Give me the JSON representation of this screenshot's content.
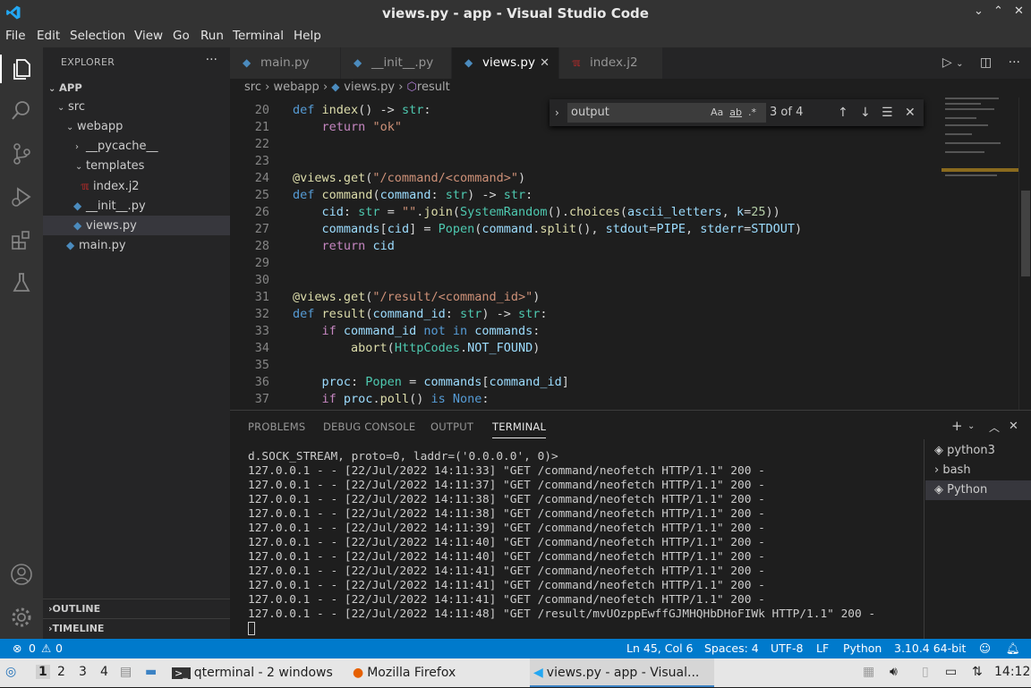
{
  "window": {
    "title": "views.py - app - Visual Studio Code",
    "controls": [
      "⌄",
      "⌃",
      "✕"
    ]
  },
  "menu": [
    "File",
    "Edit",
    "Selection",
    "View",
    "Go",
    "Run",
    "Terminal",
    "Help"
  ],
  "explorer": {
    "header": "EXPLORER",
    "more": "···",
    "root": "APP",
    "items": [
      {
        "label": "src"
      },
      {
        "label": "webapp"
      },
      {
        "label": "__pycache__"
      },
      {
        "label": "templates"
      },
      {
        "label": "index.j2"
      },
      {
        "label": "__init__.py"
      },
      {
        "label": "views.py"
      },
      {
        "label": "main.py"
      }
    ],
    "outline": "OUTLINE",
    "timeline": "TIMELINE"
  },
  "tabs": [
    {
      "label": "main.py"
    },
    {
      "label": "__init__.py"
    },
    {
      "label": "views.py"
    },
    {
      "label": "index.j2"
    }
  ],
  "breadcrumb": [
    "src",
    "webapp",
    "views.py",
    "result"
  ],
  "find": {
    "query": "output",
    "count": "3 of 4",
    "opt_case": "Aa",
    "opt_word": "ab",
    "opt_regex": ".*"
  },
  "code_lines": [
    {
      "n": "20"
    },
    {
      "n": "21"
    },
    {
      "n": "22"
    },
    {
      "n": "23"
    },
    {
      "n": "24"
    },
    {
      "n": "25"
    },
    {
      "n": "26"
    },
    {
      "n": "27"
    },
    {
      "n": "28"
    },
    {
      "n": "29"
    },
    {
      "n": "30"
    },
    {
      "n": "31"
    },
    {
      "n": "32"
    },
    {
      "n": "33"
    },
    {
      "n": "34"
    },
    {
      "n": "35"
    },
    {
      "n": "36"
    },
    {
      "n": "37"
    }
  ],
  "panel": {
    "tabs": [
      "PROBLEMS",
      "DEBUG CONSOLE",
      "OUTPUT",
      "TERMINAL"
    ],
    "active_tab": "TERMINAL",
    "terminal_lines": [
      "d.SOCK_STREAM, proto=0, laddr=('0.0.0.0', 0)>",
      "127.0.0.1 - - [22/Jul/2022 14:11:33] \"GET /command/neofetch HTTP/1.1\" 200 -",
      "127.0.0.1 - - [22/Jul/2022 14:11:37] \"GET /command/neofetch HTTP/1.1\" 200 -",
      "127.0.0.1 - - [22/Jul/2022 14:11:38] \"GET /command/neofetch HTTP/1.1\" 200 -",
      "127.0.0.1 - - [22/Jul/2022 14:11:38] \"GET /command/neofetch HTTP/1.1\" 200 -",
      "127.0.0.1 - - [22/Jul/2022 14:11:39] \"GET /command/neofetch HTTP/1.1\" 200 -",
      "127.0.0.1 - - [22/Jul/2022 14:11:40] \"GET /command/neofetch HTTP/1.1\" 200 -",
      "127.0.0.1 - - [22/Jul/2022 14:11:40] \"GET /command/neofetch HTTP/1.1\" 200 -",
      "127.0.0.1 - - [22/Jul/2022 14:11:41] \"GET /command/neofetch HTTP/1.1\" 200 -",
      "127.0.0.1 - - [22/Jul/2022 14:11:41] \"GET /command/neofetch HTTP/1.1\" 200 -",
      "127.0.0.1 - - [22/Jul/2022 14:11:41] \"GET /command/neofetch HTTP/1.1\" 200 -",
      "127.0.0.1 - - [22/Jul/2022 14:11:48] \"GET /result/mvUOzppEwffGJMHQHbDHoFIWk HTTP/1.1\" 200 -"
    ],
    "terminals": [
      "python3",
      "bash",
      "Python"
    ]
  },
  "status": {
    "errors": "0",
    "warnings": "0",
    "position": "Ln 45, Col 6",
    "spaces": "Spaces: 4",
    "encoding": "UTF-8",
    "eol": "LF",
    "language": "Python",
    "interpreter": "3.10.4 64-bit"
  },
  "taskbar": {
    "workspaces": [
      "1",
      "2",
      "3",
      "4"
    ],
    "windows": [
      "qterminal - 2 windows",
      "Mozilla Firefox",
      "views.py - app - Visual..."
    ],
    "clock": "14:12"
  },
  "colors": {
    "accent": "#007acc",
    "activitybar": "#333333",
    "sidebar": "#252526",
    "editor": "#1e1e1e"
  }
}
